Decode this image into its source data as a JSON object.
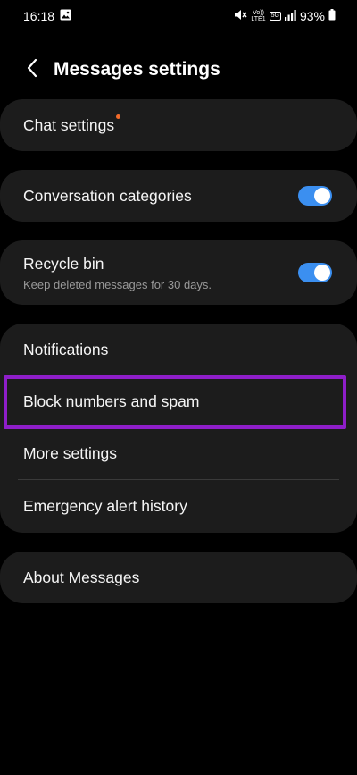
{
  "status_bar": {
    "time": "16:18",
    "network_top": "Vo))",
    "network_bottom": "LTE1",
    "network_type": "5G",
    "battery": "93%"
  },
  "header": {
    "title": "Messages settings"
  },
  "settings": {
    "chat_settings": {
      "label": "Chat settings",
      "has_badge": true
    },
    "conversation_categories": {
      "label": "Conversation categories",
      "enabled": true
    },
    "recycle_bin": {
      "label": "Recycle bin",
      "subtitle": "Keep deleted messages for 30 days.",
      "enabled": true
    },
    "notifications": {
      "label": "Notifications"
    },
    "block_numbers": {
      "label": "Block numbers and spam",
      "highlighted": true
    },
    "more_settings": {
      "label": "More settings"
    },
    "emergency_alert_history": {
      "label": "Emergency alert history"
    },
    "about_messages": {
      "label": "About Messages"
    }
  },
  "colors": {
    "background": "#000000",
    "card": "#1c1c1c",
    "toggle_on": "#3b8ff0",
    "badge": "#f26a2a",
    "highlight": "#8e1ec9"
  },
  "icons": [
    "image-icon",
    "mute-icon",
    "signal-icon",
    "battery-icon",
    "back-arrow-icon"
  ]
}
